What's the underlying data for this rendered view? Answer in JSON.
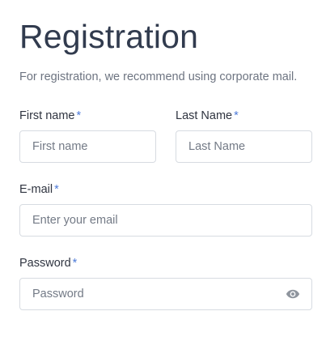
{
  "page": {
    "title": "Registration",
    "subtitle": "For registration, we recommend using corporate mail."
  },
  "form": {
    "required_marker": "*",
    "first_name": {
      "label": "First name",
      "placeholder": "First name",
      "value": ""
    },
    "last_name": {
      "label": "Last Name",
      "placeholder": "Last Name",
      "value": ""
    },
    "email": {
      "label": "E-mail",
      "placeholder": "Enter your email",
      "value": ""
    },
    "password": {
      "label": "Password",
      "placeholder": "Password",
      "value": "",
      "toggle_icon": "eye-icon"
    }
  },
  "colors": {
    "required": "#4e7bd9",
    "border": "#d7dbe1",
    "title": "#313b4e",
    "muted": "#6d7481"
  }
}
